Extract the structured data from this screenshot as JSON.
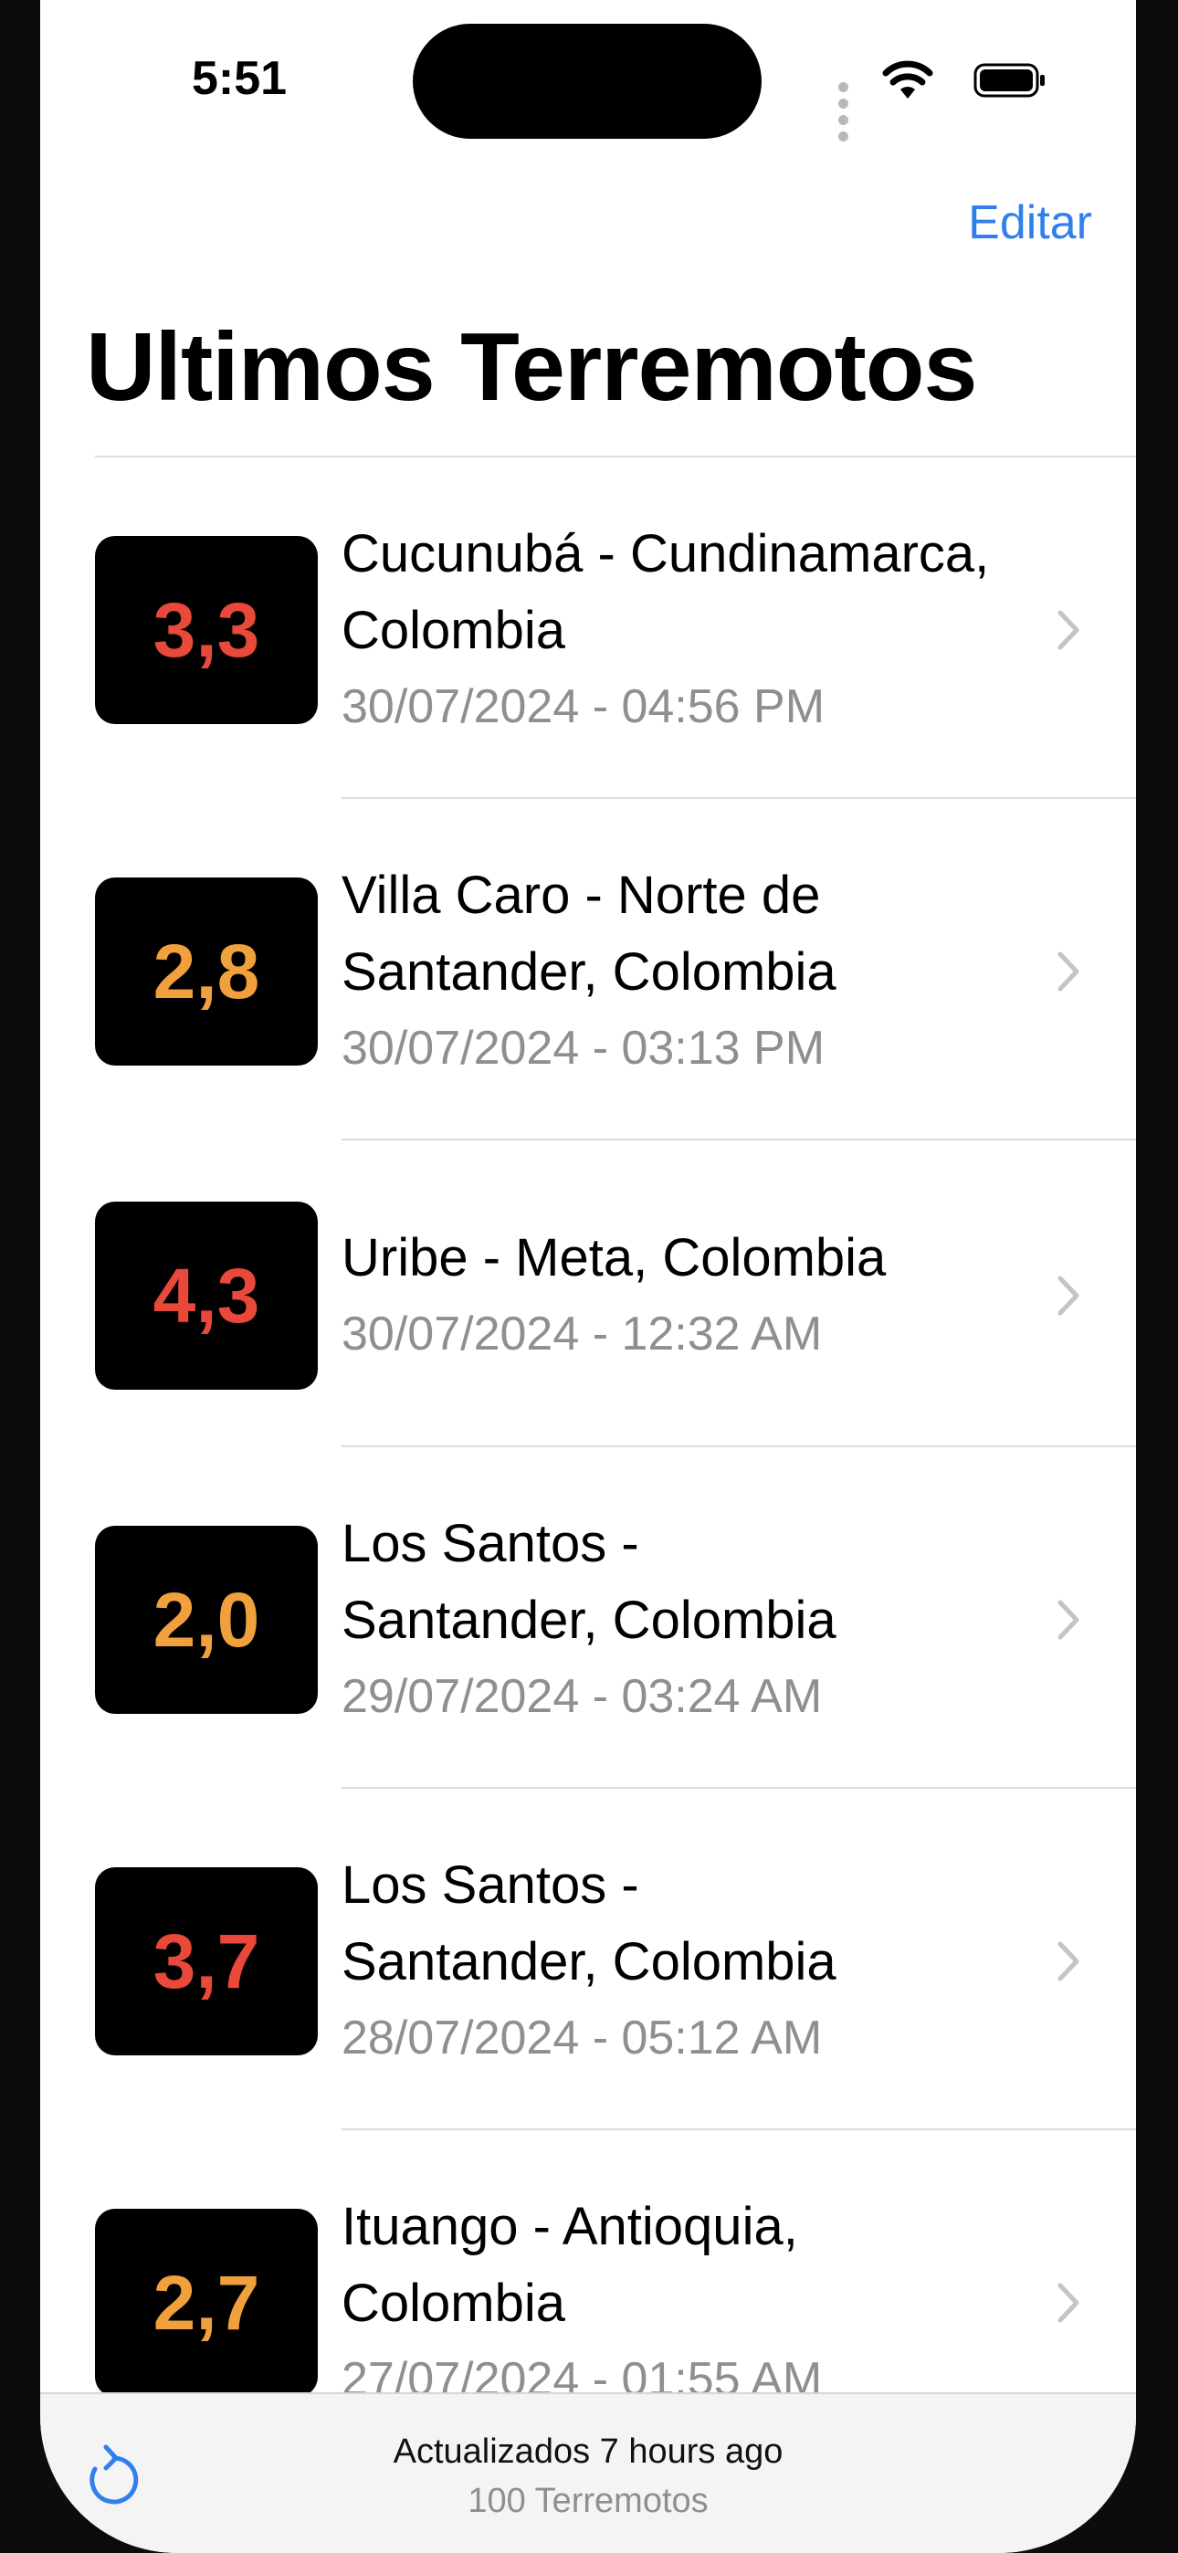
{
  "status_bar": {
    "time": "5:51"
  },
  "nav": {
    "edit_label": "Editar",
    "title": "Ultimos Terremotos"
  },
  "colors": {
    "accent": "#2f80ed",
    "mag_high": "#e8493a",
    "mag_low": "#f0a03c"
  },
  "earthquakes": [
    {
      "magnitude": "3,3",
      "level": "high",
      "place": [
        "Cucunubá - Cundinamarca,",
        "Colombia"
      ],
      "date": "30/07/2024 - 04:56 PM"
    },
    {
      "magnitude": "2,8",
      "level": "low",
      "place": [
        "Villa Caro - Norte de",
        "Santander, Colombia"
      ],
      "date": "30/07/2024 - 03:13 PM"
    },
    {
      "magnitude": "4,3",
      "level": "high",
      "place": [
        "Uribe - Meta, Colombia"
      ],
      "date": "30/07/2024 - 12:32 AM"
    },
    {
      "magnitude": "2,0",
      "level": "low",
      "place": [
        "Los Santos -",
        "Santander, Colombia"
      ],
      "date": "29/07/2024 - 03:24 AM"
    },
    {
      "magnitude": "3,7",
      "level": "high",
      "place": [
        "Los Santos -",
        "Santander, Colombia"
      ],
      "date": "28/07/2024 - 05:12 AM"
    },
    {
      "magnitude": "2,7",
      "level": "low",
      "place": [
        "Ituango - Antioquia,",
        "Colombia"
      ],
      "date": "27/07/2024 - 01:55 AM"
    }
  ],
  "toolbar": {
    "updated": "Actualizados 7 hours ago",
    "count": "100 Terremotos",
    "refresh_icon": "refresh-icon"
  }
}
